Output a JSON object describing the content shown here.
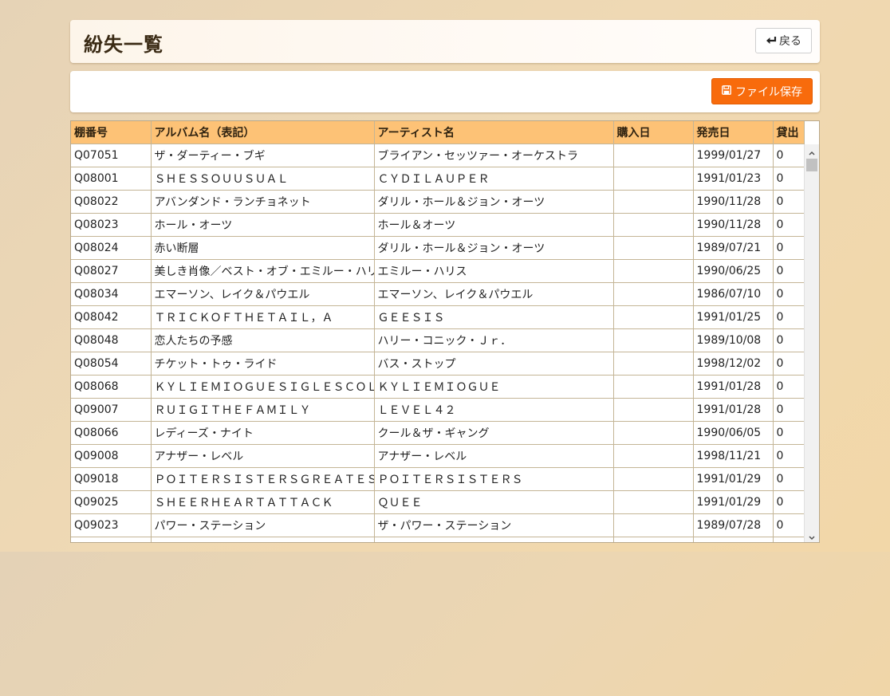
{
  "header": {
    "title": "紛失一覧",
    "back_label": "戻る"
  },
  "toolbar": {
    "save_label": "ファイル保存"
  },
  "table": {
    "columns": [
      "棚番号",
      "アルバム名（表記）",
      "アーティスト名",
      "購入日",
      "発売日",
      "貸出"
    ],
    "rows": [
      [
        "Q07051",
        "ザ・ダーティー・ブギ",
        "ブライアン・セッツァー・オーケストラ",
        "",
        "1999/01/27",
        "0"
      ],
      [
        "Q08001",
        "ＳＨＥＳＳＯＵＵＳＵＡＬ",
        "ＣＹＤＩＬＡＵＰＥＲ",
        "",
        "1991/01/23",
        "0"
      ],
      [
        "Q08022",
        "アバンダンド・ランチョネット",
        "ダリル・ホール＆ジョン・オーツ",
        "",
        "1990/11/28",
        "0"
      ],
      [
        "Q08023",
        "ホール・オーツ",
        "ホール＆オーツ",
        "",
        "1990/11/28",
        "0"
      ],
      [
        "Q08024",
        "赤い断層",
        "ダリル・ホール＆ジョン・オーツ",
        "",
        "1989/07/21",
        "0"
      ],
      [
        "Q08027",
        "美しき肖像／ベスト・オブ・エミルー・ハリス",
        "エミルー・ハリス",
        "",
        "1990/06/25",
        "0"
      ],
      [
        "Q08034",
        "エマーソン、レイク＆パウエル",
        "エマーソン、レイク＆パウエル",
        "",
        "1986/07/10",
        "0"
      ],
      [
        "Q08042",
        "ＴＲＩＣＫＯＦＴＨＥＴＡＩＬ，Ａ",
        "ＧＥＥＳＩＳ",
        "",
        "1991/01/25",
        "0"
      ],
      [
        "Q08048",
        "恋人たちの予感",
        "ハリー・コニック・Ｊｒ．",
        "",
        "1989/10/08",
        "0"
      ],
      [
        "Q08054",
        "チケット・トゥ・ライド",
        "バス・ストップ",
        "",
        "1998/12/02",
        "0"
      ],
      [
        "Q08068",
        "ＫＹＬＩＥＭＩＯＧＵＥＳＩＧＬＥＳＣＯＬＬＥＣＴＩＯＮ",
        "ＫＹＬＩＥＭＩＯＧＵＥ",
        "",
        "1991/01/28",
        "0"
      ],
      [
        "Q09007",
        "ＲＵＩＧＩＴＨＥＦＡＭＩＬＹ",
        "ＬＥＶＥＬ４２",
        "",
        "1991/01/28",
        "0"
      ],
      [
        "Q08066",
        "レディーズ・ナイト",
        "クール＆ザ・ギャング",
        "",
        "1990/06/05",
        "0"
      ],
      [
        "Q09008",
        "アナザー・レベル",
        "アナザー・レベル",
        "",
        "1998/11/21",
        "0"
      ],
      [
        "Q09018",
        "ＰＯＩＴＥＲＳＩＳＴＥＲＳＧＲＥＡＴＥＳＴＨＩＴＳ",
        "ＰＯＩＴＥＲＳＩＳＴＥＲＳ",
        "",
        "1991/01/29",
        "0"
      ],
      [
        "Q09025",
        "ＳＨＥＥＲＨＥＡＲＴＡＴＴＡＣＫ",
        "ＱＵＥＥ",
        "",
        "1991/01/29",
        "0"
      ],
      [
        "Q09023",
        "パワー・ステーション",
        "ザ・パワー・ステーション",
        "",
        "1989/07/28",
        "0"
      ],
      [
        "",
        "",
        "",
        "",
        "",
        ""
      ]
    ]
  },
  "icons": {
    "back": "return-arrow-icon",
    "save": "floppy-disk-icon"
  },
  "colors": {
    "accent": "#f86b0c",
    "header_row": "#fdc276"
  }
}
